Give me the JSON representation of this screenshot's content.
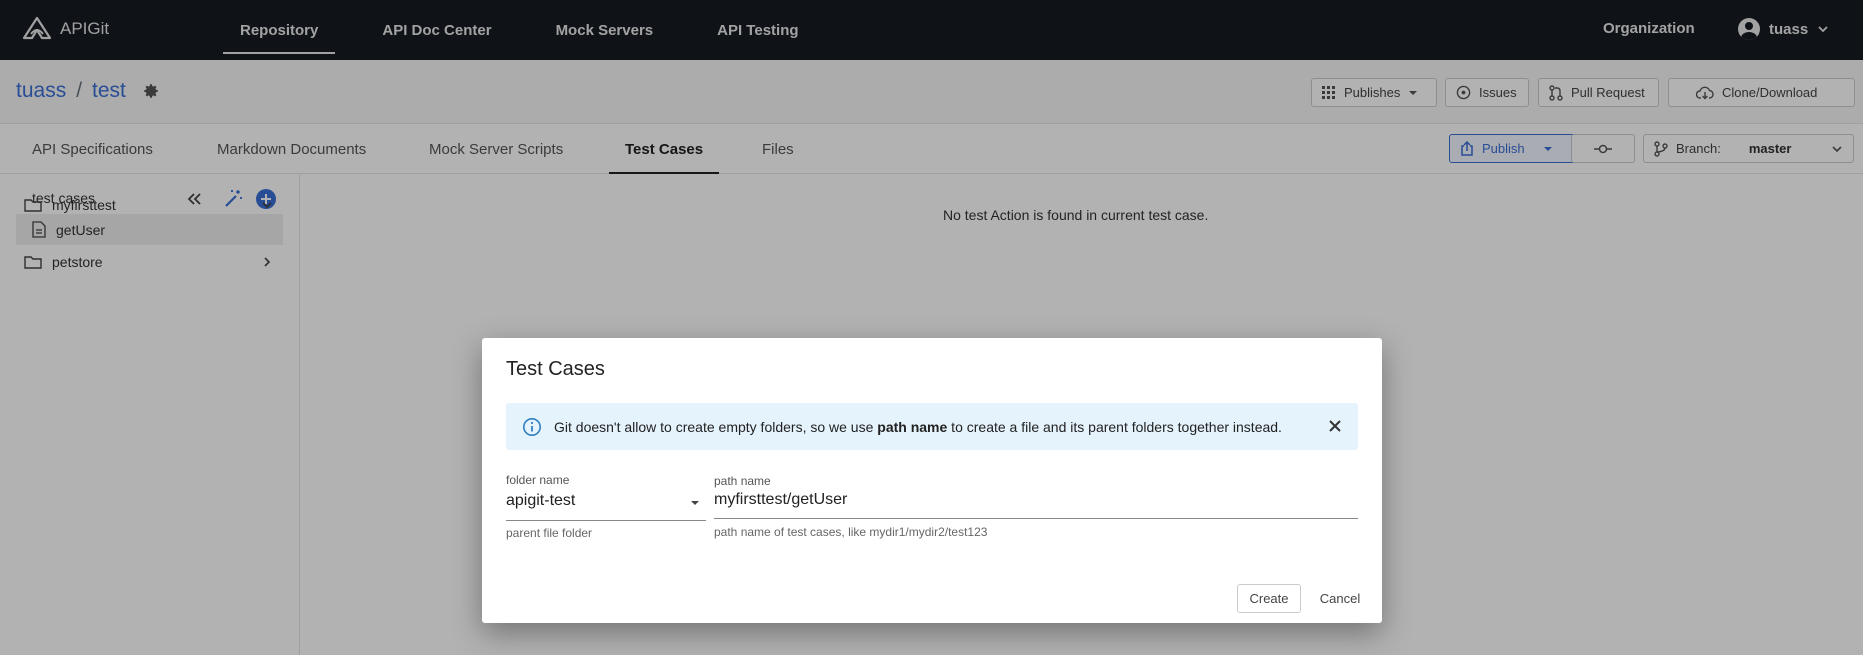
{
  "app": {
    "name": "APIGit"
  },
  "topnav": {
    "items": [
      {
        "label": "Repository"
      },
      {
        "label": "API Doc Center"
      },
      {
        "label": "Mock Servers"
      },
      {
        "label": "API Testing"
      }
    ],
    "org_label": "Organization",
    "username": "tuass"
  },
  "repo": {
    "owner": "tuass",
    "separator": "/",
    "name": "test",
    "buttons": {
      "publishes": "Publishes",
      "issues": "Issues",
      "pull_request": "Pull Request",
      "clone": "Clone/Download"
    }
  },
  "tabs": [
    {
      "label": "API Specifications"
    },
    {
      "label": "Markdown Documents"
    },
    {
      "label": "Mock Server Scripts"
    },
    {
      "label": "Test Cases"
    },
    {
      "label": "Files"
    }
  ],
  "toolbar": {
    "publish": "Publish",
    "branch_label": "Branch:",
    "branch_value": "master"
  },
  "sidebar": {
    "title": "test cases",
    "tree": [
      {
        "label": "myfirsttest"
      },
      {
        "label": "getUser"
      },
      {
        "label": "petstore"
      }
    ]
  },
  "main": {
    "empty_message": "No test Action is found in current test case."
  },
  "dialog": {
    "title": "Test Cases",
    "alert": {
      "text_before": "Git doesn't allow to create empty folders, so we use ",
      "bold": "path name",
      "text_after": " to create a file and its parent folders together instead."
    },
    "folder": {
      "label": "folder name",
      "value": "apigit-test",
      "help": "parent file folder"
    },
    "path": {
      "label": "path name",
      "value": "myfirsttest/getUser",
      "help": "path name of test cases, like mydir1/mydir2/test123"
    },
    "create_label": "Create",
    "cancel_label": "Cancel"
  },
  "colors": {
    "nav_bg": "#161b22",
    "link": "#3b6fd6",
    "alert_bg": "#e5f3fc",
    "add_button": "#3b6fd6"
  }
}
